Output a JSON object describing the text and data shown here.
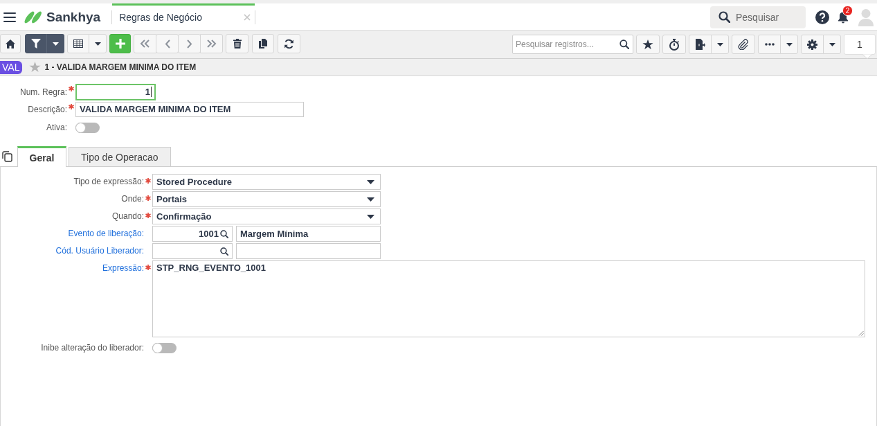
{
  "app_bar": {
    "brand": "Sankhya",
    "tabs": [
      {
        "label": "Regras de Negócio",
        "selected": true
      }
    ],
    "search": {
      "placeholder": "Pesquisar"
    },
    "notifications": {
      "badge": "2"
    }
  },
  "toolbar": {
    "filter_active": true,
    "search": {
      "placeholder": "Pesquisar registros..."
    },
    "page": "1"
  },
  "record": {
    "badge": "VAL",
    "favorite": false,
    "title": "1 - VALIDA MARGEM MINIMA DO ITEM"
  },
  "header_fields": [
    {
      "label": "Num. Regra:",
      "required": true,
      "kind": "number",
      "value": "1",
      "focused": true
    },
    {
      "label": "Descrição:",
      "required": true,
      "kind": "text",
      "value": "VALIDA MARGEM MINIMA DO ITEM",
      "focused": false
    },
    {
      "label": "Ativa:",
      "required": false,
      "kind": "toggle",
      "on": false,
      "focused": false
    }
  ],
  "tabs": [
    {
      "label": "Geral",
      "selected": true
    },
    {
      "label": "Tipo de Operacao",
      "selected": false
    }
  ],
  "fields": [
    {
      "label": "Tipo de expressão:",
      "required": true,
      "link": false,
      "kind": "select",
      "value": "Stored Procedure"
    },
    {
      "label": "Onde:",
      "required": true,
      "link": false,
      "kind": "select",
      "value": "Portais"
    },
    {
      "label": "Quando:",
      "required": true,
      "link": false,
      "kind": "select",
      "value": "Confirmação"
    },
    {
      "label": "Evento de liberação:",
      "required": false,
      "link": true,
      "kind": "lookup",
      "code": "1001",
      "value": "Margem Mínima"
    },
    {
      "label": "Cód. Usuário Liberador:",
      "required": false,
      "link": true,
      "kind": "lookup"
    },
    {
      "label": "Expressão:",
      "required": true,
      "link": true,
      "kind": "textarea",
      "value": "STP_RNG_EVENTO_1001"
    },
    {
      "label": "Inibe alteração do liberador:",
      "required": false,
      "link": false,
      "kind": "toggle",
      "on": false
    }
  ]
}
